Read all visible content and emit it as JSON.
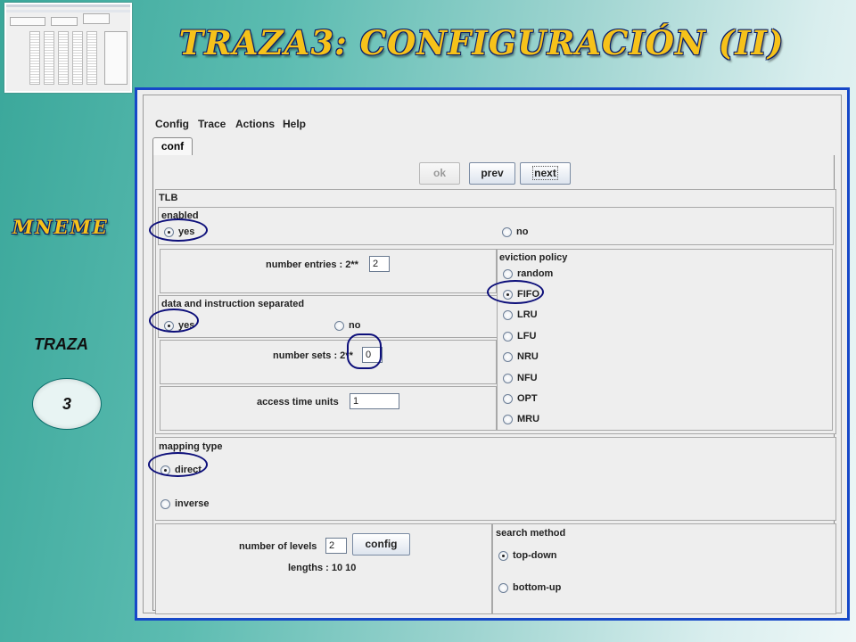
{
  "slide": {
    "title": "TRAZA3: CONFIGURACIÓN (II)",
    "side_title": "MNEME",
    "section_label": "TRAZA",
    "step_number": "3"
  },
  "menu": [
    "Config",
    "Trace",
    "Actions",
    "Help"
  ],
  "tabs": [
    "conf"
  ],
  "buttons": {
    "ok": "ok",
    "prev": "prev",
    "next": "next"
  },
  "tlb": {
    "section_label": "TLB",
    "enabled_label": "enabled",
    "enabled_yes": "yes",
    "enabled_no": "no",
    "number_entries_label": "number entries : 2**",
    "number_entries_value": "2",
    "separated_label": "data and instruction separated",
    "separated_yes": "yes",
    "separated_no": "no",
    "number_sets_label": "number sets : 2**",
    "number_sets_value": "0",
    "access_time_label": "access time units",
    "access_time_value": "1",
    "eviction_label": "eviction policy",
    "eviction_options": [
      "random",
      "FIFO",
      "LRU",
      "LFU",
      "NRU",
      "NFU",
      "OPT",
      "MRU"
    ],
    "eviction_selected": "FIFO"
  },
  "mapping": {
    "label": "mapping type",
    "options": [
      "direct",
      "inverse"
    ],
    "selected": "direct"
  },
  "levels": {
    "label": "number of levels",
    "value": "2",
    "config_button": "config",
    "lengths_text": "lengths : 10 10"
  },
  "search": {
    "label": "search method",
    "options": [
      "top-down",
      "bottom-up"
    ],
    "selected": "top-down"
  },
  "colors": {
    "title_fill": "#f6c21a",
    "title_outline": "#0a1f6c",
    "window_border": "#1648c8",
    "highlight": "#0d0f7a"
  }
}
